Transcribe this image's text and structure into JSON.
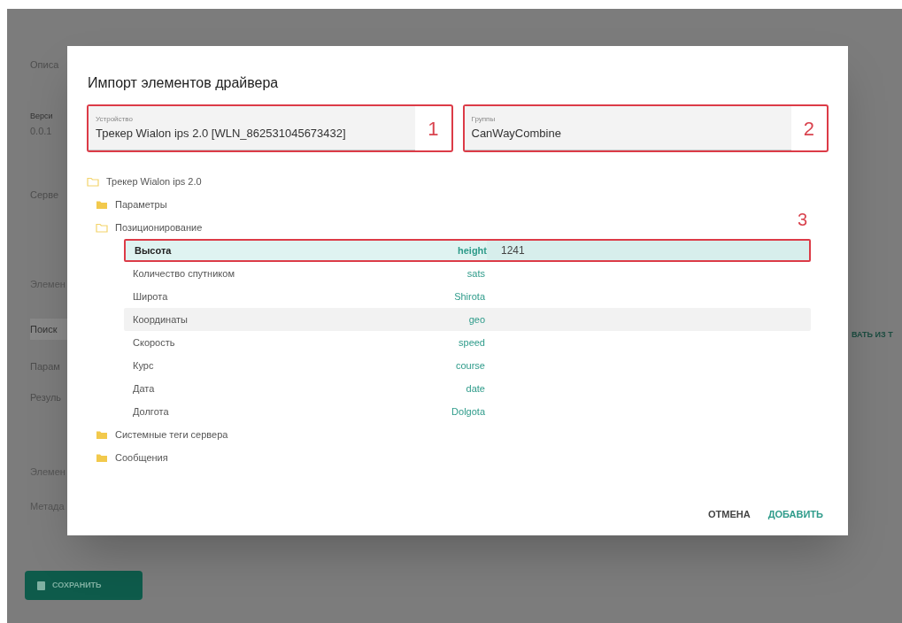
{
  "background_page": {
    "texts": [
      {
        "kind": "field",
        "text": "Описа"
      },
      {
        "kind": "label",
        "text": "Верси"
      },
      {
        "kind": "field",
        "text": "0.0.1"
      },
      {
        "kind": "field",
        "text": "Серве"
      },
      {
        "kind": "heading",
        "text": "Элемен"
      },
      {
        "kind": "search",
        "text": "Поиск"
      },
      {
        "kind": "item",
        "text": "Парам"
      },
      {
        "kind": "item",
        "text": "Резуль"
      },
      {
        "kind": "heading",
        "text": "Элемен"
      },
      {
        "kind": "heading",
        "text": "Метада"
      }
    ],
    "right_link": "ВАТЬ ИЗ Т",
    "save_button": "СОХРАНИТЬ"
  },
  "dialog": {
    "title": "Импорт элементов драйвера",
    "fields": [
      {
        "label": "Устройство",
        "value": "Трекер Wialon ips 2.0 [WLN_862531045673432]",
        "annotation": "1"
      },
      {
        "label": "Группы",
        "value": "CanWayCombine",
        "annotation": "2"
      }
    ],
    "tree": {
      "label": "Трекер Wialon ips 2.0",
      "kind": "folder",
      "expanded": true,
      "children": [
        {
          "label": "Параметры",
          "kind": "folder",
          "expanded": false
        },
        {
          "label": "Позиционирование",
          "kind": "folder",
          "expanded": true,
          "annotation": "3",
          "children": [
            {
              "kind": "param",
              "name": "Высота",
              "tag": "height",
              "value": "1241",
              "selected": true,
              "hovered": false
            },
            {
              "kind": "param",
              "name": "Количество спутником",
              "tag": "sats",
              "selected": false,
              "hovered": false
            },
            {
              "kind": "param",
              "name": "Широта",
              "tag": "Shirota",
              "selected": false,
              "hovered": false
            },
            {
              "kind": "param",
              "name": "Координаты",
              "tag": "geo",
              "selected": false,
              "hovered": true
            },
            {
              "kind": "param",
              "name": "Скорость",
              "tag": "speed",
              "selected": false,
              "hovered": false
            },
            {
              "kind": "param",
              "name": "Курс",
              "tag": "course",
              "selected": false,
              "hovered": false
            },
            {
              "kind": "param",
              "name": "Дата",
              "tag": "date",
              "selected": false,
              "hovered": false
            },
            {
              "kind": "param",
              "name": "Долгота",
              "tag": "Dolgota",
              "selected": false,
              "hovered": false
            }
          ]
        },
        {
          "label": "Системные теги сервера",
          "kind": "folder",
          "expanded": false
        },
        {
          "label": "Сообщения",
          "kind": "folder",
          "expanded": false
        }
      ]
    },
    "buttons": [
      {
        "label": "ОТМЕНА",
        "kind": "cancel"
      },
      {
        "label": "ДОБАВИТЬ",
        "kind": "primary"
      }
    ]
  }
}
